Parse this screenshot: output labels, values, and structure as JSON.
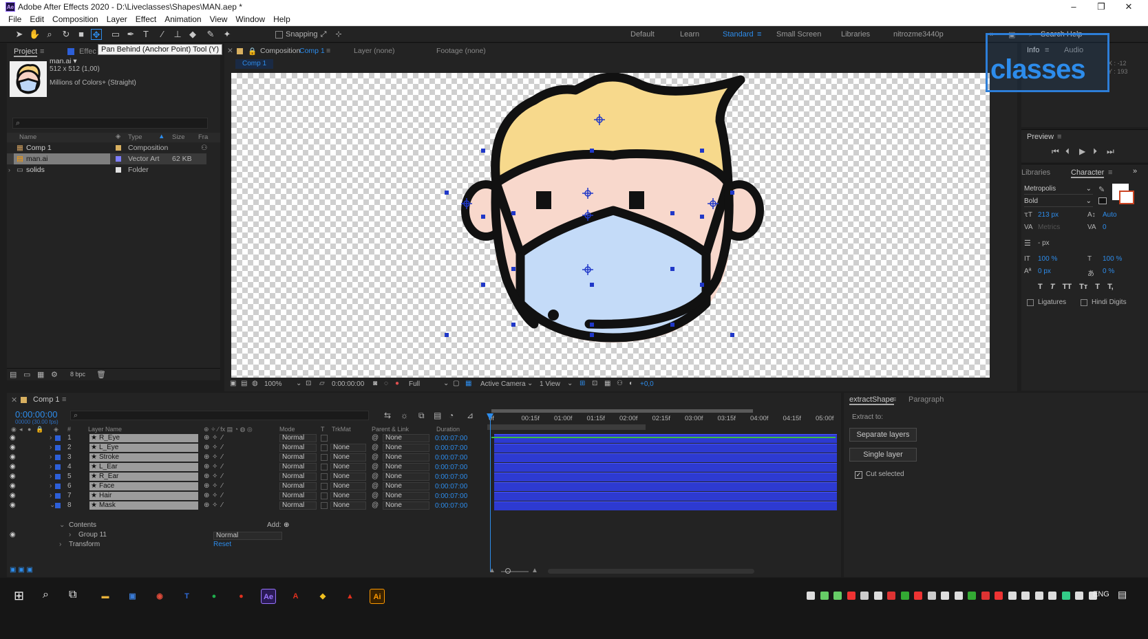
{
  "app": {
    "title": "Adobe After Effects 2020 - D:\\Liveclasses\\Shapes\\MAN.aep *",
    "icon_label": "Ae"
  },
  "window": {
    "minimize": "–",
    "maximize": "❐",
    "close": "✕"
  },
  "menu": [
    "File",
    "Edit",
    "Composition",
    "Layer",
    "Effect",
    "Animation",
    "View",
    "Window",
    "Help"
  ],
  "toolbar": {
    "snapping_label": "Snapping",
    "tooltip": "Pan Behind (Anchor Point) Tool (Y)",
    "workspaces": [
      "Default",
      "Learn",
      "Standard",
      "Small Screen",
      "Libraries",
      "nitrozme3440p"
    ],
    "active_workspace": "Standard",
    "search_help": "Search Help"
  },
  "project": {
    "tab_project": "Project",
    "tab_effects": "Effec",
    "asset_name": "man.ai ▾",
    "asset_dims": "512 x 512 (1,00)",
    "asset_colors": "Millions of Colors+ (Straight)",
    "columns": [
      "Name",
      "Type",
      "Size",
      "Fra"
    ],
    "items": [
      {
        "name": "Comp 1",
        "type": "Composition",
        "size": "",
        "color": "#d8b060"
      },
      {
        "name": "man.ai",
        "type": "Vector Art",
        "size": "62 KB",
        "color": "#7f7fff"
      },
      {
        "name": "solids",
        "type": "Folder",
        "size": "",
        "color": "#e0e0e0"
      }
    ],
    "bpc": "8 bpc"
  },
  "composition": {
    "tab_label": "Composition",
    "tab_comp": "Comp 1",
    "layer_tab": "Layer (none)",
    "footage_tab": "Footage (none)",
    "breadcrumb": "Comp 1",
    "zoom": "100%",
    "timecode": "0:00:00:00",
    "resolution": "Full",
    "camera": "Active Camera",
    "views": "1 View",
    "exposure": "+0,0"
  },
  "watermark": "classes",
  "info": {
    "tab_info": "Info",
    "tab_audio": "Audio",
    "x": "X : -12",
    "y": "Y : 193"
  },
  "preview": {
    "label": "Preview",
    "buttons": [
      "⏮",
      "⏴",
      "▶",
      "⏵",
      "⏭"
    ]
  },
  "character": {
    "tab_libraries": "Libraries",
    "tab_character": "Character",
    "font": "Metropolis",
    "style": "Bold",
    "size": "213 px",
    "leading": "Auto",
    "kerning": "Metrics",
    "tracking": "0",
    "stroke": "- px",
    "vscale": "100 %",
    "hscale": "100 %",
    "baseline": "0 px",
    "tsume": "0 %",
    "styles": [
      "T",
      "T",
      "TT",
      "Tт",
      "T",
      "T,"
    ],
    "ligatures": "Ligatures",
    "hindi_digits": "Hindi Digits"
  },
  "timeline": {
    "tab": "Comp 1",
    "timecode": "0:00:00:00",
    "fps": "00000 (30.00 fps)",
    "columns": {
      "layer_name": "Layer Name",
      "mode": "Mode",
      "t": "T",
      "trkmat": "TrkMat",
      "parent": "Parent & Link",
      "duration": "Duration"
    },
    "ruler": [
      "0f",
      "00:15f",
      "01:00f",
      "01:15f",
      "02:00f",
      "02:15f",
      "03:00f",
      "03:15f",
      "04:00f",
      "04:15f",
      "05:00f"
    ],
    "layers": [
      {
        "num": "1",
        "name": "R_Eye",
        "mode": "Normal",
        "trkmat": "",
        "parent": "None",
        "duration": "0:00:07:00"
      },
      {
        "num": "2",
        "name": "L_Eye",
        "mode": "Normal",
        "trkmat": "None",
        "parent": "None",
        "duration": "0:00:07:00"
      },
      {
        "num": "3",
        "name": "Stroke",
        "mode": "Normal",
        "trkmat": "None",
        "parent": "None",
        "duration": "0:00:07:00"
      },
      {
        "num": "4",
        "name": "L_Ear",
        "mode": "Normal",
        "trkmat": "None",
        "parent": "None",
        "duration": "0:00:07:00"
      },
      {
        "num": "5",
        "name": "R_Ear",
        "mode": "Normal",
        "trkmat": "None",
        "parent": "None",
        "duration": "0:00:07:00"
      },
      {
        "num": "6",
        "name": "Face",
        "mode": "Normal",
        "trkmat": "None",
        "parent": "None",
        "duration": "0:00:07:00"
      },
      {
        "num": "7",
        "name": "Hair",
        "mode": "Normal",
        "trkmat": "None",
        "parent": "None",
        "duration": "0:00:07:00"
      },
      {
        "num": "8",
        "name": "Mask",
        "mode": "Normal",
        "trkmat": "None",
        "parent": "None",
        "duration": "0:00:07:00"
      }
    ],
    "contents": "Contents",
    "add": "Add:",
    "group": "Group 11",
    "group_mode": "Normal",
    "transform": "Transform",
    "reset": "Reset"
  },
  "extract": {
    "tab": "extractShape",
    "tab_paragraph": "Paragraph",
    "extract_to": "Extract to:",
    "separate": "Separate layers",
    "single": "Single layer",
    "cut_selected": "Cut selected"
  },
  "taskbar": {
    "lang": "ENG",
    "apps": [
      {
        "name": "file-explorer",
        "glyph": "▬",
        "color": "#e8b23a"
      },
      {
        "name": "save-app",
        "glyph": "▣",
        "color": "#3a7bd5"
      },
      {
        "name": "chrome",
        "glyph": "◉",
        "color": "#e04b3a"
      },
      {
        "name": "teams",
        "glyph": "T",
        "color": "#2f6bd8"
      },
      {
        "name": "green-app",
        "glyph": "●",
        "color": "#1fae4c"
      },
      {
        "name": "recorder",
        "glyph": "●",
        "color": "#e0301e"
      },
      {
        "name": "after-effects",
        "glyph": "Ae",
        "color": "#9a75ff"
      },
      {
        "name": "acrobat",
        "glyph": "A",
        "color": "#e0301e"
      },
      {
        "name": "shield-app",
        "glyph": "◆",
        "color": "#f0c020"
      },
      {
        "name": "red-app",
        "glyph": "▲",
        "color": "#e0301e"
      },
      {
        "name": "illustrator",
        "glyph": "Ai",
        "color": "#ff9a00"
      }
    ]
  }
}
